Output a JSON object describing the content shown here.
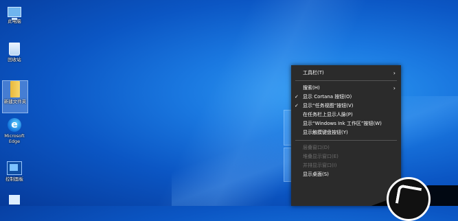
{
  "desktop": {
    "icons": [
      {
        "label": "此电脑",
        "icon": "computer-icon"
      },
      {
        "label": "回收站",
        "icon": "recycle-bin-icon"
      },
      {
        "label": "新建文件夹",
        "icon": "folder-icon"
      },
      {
        "label": "Microsoft Edge",
        "icon": "edge-icon"
      },
      {
        "label": "控制面板",
        "icon": "control-panel-icon"
      },
      {
        "label": "",
        "icon": "app-icon"
      }
    ]
  },
  "context_menu": {
    "items": [
      {
        "label": "工具栏(T)",
        "submenu": true
      },
      {
        "label": "搜索(H)",
        "submenu": true
      },
      {
        "label": "显示 Cortana 按钮(O)",
        "checked": true
      },
      {
        "label": "显示“任务视图”按钮(V)",
        "checked": true
      },
      {
        "label": "在任务栏上显示人脉(P)"
      },
      {
        "label": "显示“Windows Ink 工作区”按钮(W)"
      },
      {
        "label": "显示触摸键盘按钮(Y)"
      },
      {
        "label": "层叠窗口(D)",
        "disabled": true
      },
      {
        "label": "堆叠显示窗口(E)",
        "disabled": true
      },
      {
        "label": "并排显示窗口(I)",
        "disabled": true
      },
      {
        "label": "显示桌面(S)"
      }
    ],
    "check_glyph": "✓",
    "submenu_glyph": "›"
  },
  "colors": {
    "desktop_bg": "#0b56c4",
    "menu_bg": "#2b2b2b",
    "menu_text": "#ffffff",
    "menu_disabled": "#6e6e6e"
  }
}
